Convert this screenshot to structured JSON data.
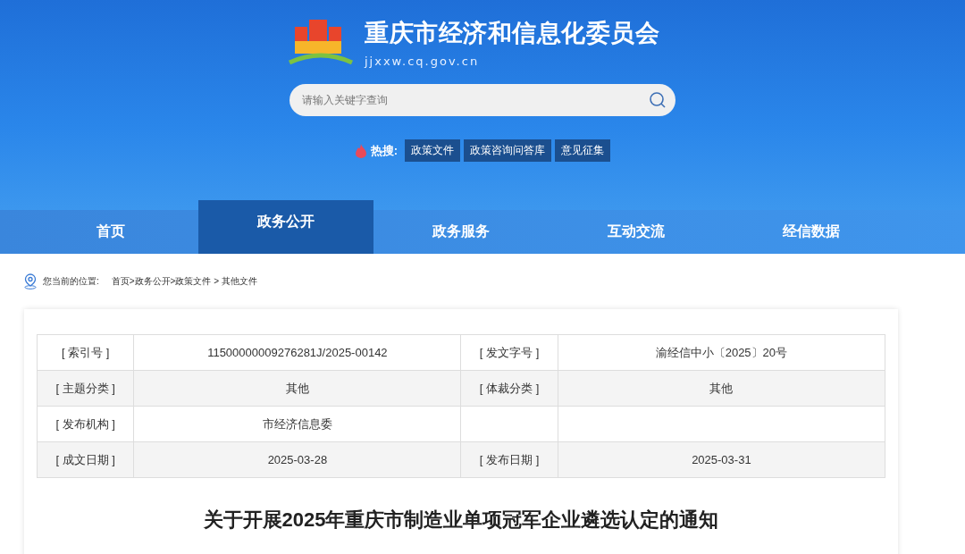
{
  "header": {
    "site_name": "重庆市经济和信息化委员会",
    "domain": "jjxxw.cq.gov.cn"
  },
  "search": {
    "placeholder": "请输入关键字查询"
  },
  "hot_search": {
    "label": "热搜:",
    "tags": [
      "政策文件",
      "政策咨询问答库",
      "意见征集"
    ]
  },
  "nav": [
    {
      "label": "首页",
      "selected": false
    },
    {
      "label": "政务公开",
      "selected": true
    },
    {
      "label": "政务服务",
      "selected": false
    },
    {
      "label": "互动交流",
      "selected": false
    },
    {
      "label": "经信数据",
      "selected": false
    }
  ],
  "breadcrumb": {
    "label": "您当前的位置:",
    "path": "首页>政务公开>政策文件 > 其他文件"
  },
  "info_table": {
    "rows": [
      [
        "[ 索引号 ]",
        "11500000009276281J/2025-00142",
        "[ 发文字号 ]",
        "渝经信中小〔2025〕20号"
      ],
      [
        "[ 主题分类 ]",
        "其他",
        "[ 体裁分类 ]",
        "其他"
      ],
      [
        "[ 发布机构 ]",
        "市经济信息委",
        "",
        ""
      ],
      [
        "[ 成文日期 ]",
        "2025-03-28",
        "[ 发布日期 ]",
        "2025-03-31"
      ]
    ]
  },
  "article": {
    "title": "关于开展2025年重庆市制造业单项冠军企业遴选认定的通知"
  }
}
